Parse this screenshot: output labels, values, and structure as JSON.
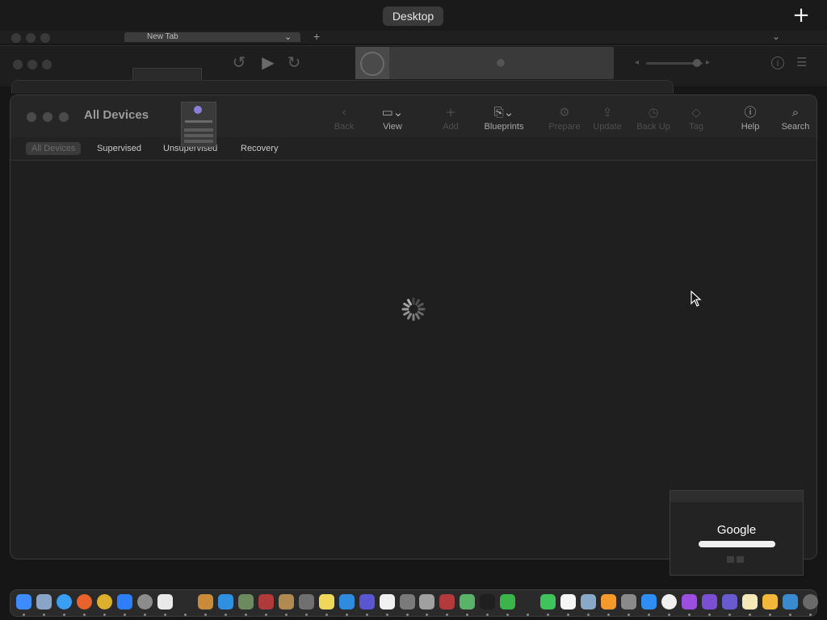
{
  "mission_control": {
    "space_label": "Desktop",
    "add_space_icon": "plus-icon"
  },
  "background_browser": {
    "tab_title": "New Tab"
  },
  "main_window": {
    "title": "All Devices",
    "toolbar": [
      {
        "id": "back",
        "label": "Back",
        "icon": "chevron-left-icon",
        "glyph": "‹",
        "enabled": false
      },
      {
        "id": "view",
        "label": "View",
        "icon": "view-icon",
        "glyph": "▭⌄",
        "enabled": true
      },
      {
        "id": "add",
        "label": "Add",
        "icon": "plus-icon",
        "glyph": "+",
        "enabled": false
      },
      {
        "id": "blueprints",
        "label": "Blueprints",
        "icon": "blueprints-icon",
        "glyph": "⎘⌄",
        "enabled": true
      },
      {
        "id": "prepare",
        "label": "Prepare",
        "icon": "prepare-icon",
        "glyph": "⚙",
        "enabled": false
      },
      {
        "id": "update",
        "label": "Update",
        "icon": "update-icon",
        "glyph": "⇪",
        "enabled": false
      },
      {
        "id": "backup",
        "label": "Back Up",
        "icon": "backup-icon",
        "glyph": "◷",
        "enabled": false
      },
      {
        "id": "tag",
        "label": "Tag",
        "icon": "tag-icon",
        "glyph": "◇",
        "enabled": false
      },
      {
        "id": "help",
        "label": "Help",
        "icon": "help-icon",
        "glyph": "ⓘ",
        "enabled": true
      },
      {
        "id": "search",
        "label": "Search",
        "icon": "search-icon",
        "glyph": "⌕",
        "enabled": true
      }
    ],
    "tabs": [
      {
        "label": "All Devices",
        "selected": true
      },
      {
        "label": "Supervised",
        "selected": false
      },
      {
        "label": "Unsupervised",
        "selected": false
      },
      {
        "label": "Recovery",
        "selected": false
      }
    ],
    "loading": true
  },
  "chrome_thumbnail": {
    "logo_text": "Google"
  },
  "dock": {
    "apps": [
      {
        "name": "finder-icon",
        "color": "#3d8bfd"
      },
      {
        "name": "launchpad-icon",
        "color": "#8aa4c8"
      },
      {
        "name": "safari-icon",
        "color": "#3a9ef5"
      },
      {
        "name": "firefox-icon",
        "color": "#e8632b"
      },
      {
        "name": "chrome-icon",
        "color": "#dcb02d"
      },
      {
        "name": "app-store-icon",
        "color": "#2d7ff9"
      },
      {
        "name": "system-settings-icon",
        "color": "#8c8c8c"
      },
      {
        "name": "textedit-icon",
        "color": "#e9e9e9"
      },
      {
        "name": "terminal-icon",
        "color": "#2b2b2b"
      },
      {
        "name": "brush-app-icon",
        "color": "#c98a3a"
      },
      {
        "name": "vscode-icon",
        "color": "#2f8fe0"
      },
      {
        "name": "utility-app-icon",
        "color": "#6b8a5d"
      },
      {
        "name": "red-utility-icon",
        "color": "#b03a3a"
      },
      {
        "name": "bag-app-icon",
        "color": "#b08a50"
      },
      {
        "name": "photo-booth-icon",
        "color": "#707070"
      },
      {
        "name": "notes-app-icon",
        "color": "#f1d65c"
      },
      {
        "name": "cloud-app-icon",
        "color": "#2f8bdf"
      },
      {
        "name": "layers-app-icon",
        "color": "#5a55d0"
      },
      {
        "name": "news-icon",
        "color": "#f0f0f0"
      },
      {
        "name": "font-book-icon",
        "color": "#7a7a7a"
      },
      {
        "name": "chess-icon",
        "color": "#a0a0a0"
      },
      {
        "name": "dictionary-icon",
        "color": "#b33a3a"
      },
      {
        "name": "maps-icon",
        "color": "#5bb36a"
      },
      {
        "name": "apple-tv-icon",
        "color": "#1f1f1f"
      },
      {
        "name": "find-my-icon",
        "color": "#39b54a"
      },
      {
        "name": "stocks-icon",
        "color": "#2a2a2a"
      },
      {
        "name": "messages-icon",
        "color": "#3ec45a"
      },
      {
        "name": "calendar-icon",
        "color": "#f5f5f5"
      },
      {
        "name": "preview-icon",
        "color": "#8aa9c8"
      },
      {
        "name": "books-icon",
        "color": "#f39a2b"
      },
      {
        "name": "calculator-icon",
        "color": "#8a8a8a"
      },
      {
        "name": "keynote-icon",
        "color": "#2e8ef3"
      },
      {
        "name": "clock-icon",
        "color": "#f0f0f0"
      },
      {
        "name": "podcasts-icon",
        "color": "#9b4ee0"
      },
      {
        "name": "visual-studio-icon",
        "color": "#7a4fd1"
      },
      {
        "name": "configurator-icon",
        "color": "#6a5ad0"
      },
      {
        "name": "folder-icon",
        "color": "#f5e9b8"
      },
      {
        "name": "archive-icon",
        "color": "#f3b839"
      },
      {
        "name": "proxy-app-icon",
        "color": "#3a8ad0"
      },
      {
        "name": "trash-icon",
        "color": "#6a6a6a"
      }
    ]
  }
}
